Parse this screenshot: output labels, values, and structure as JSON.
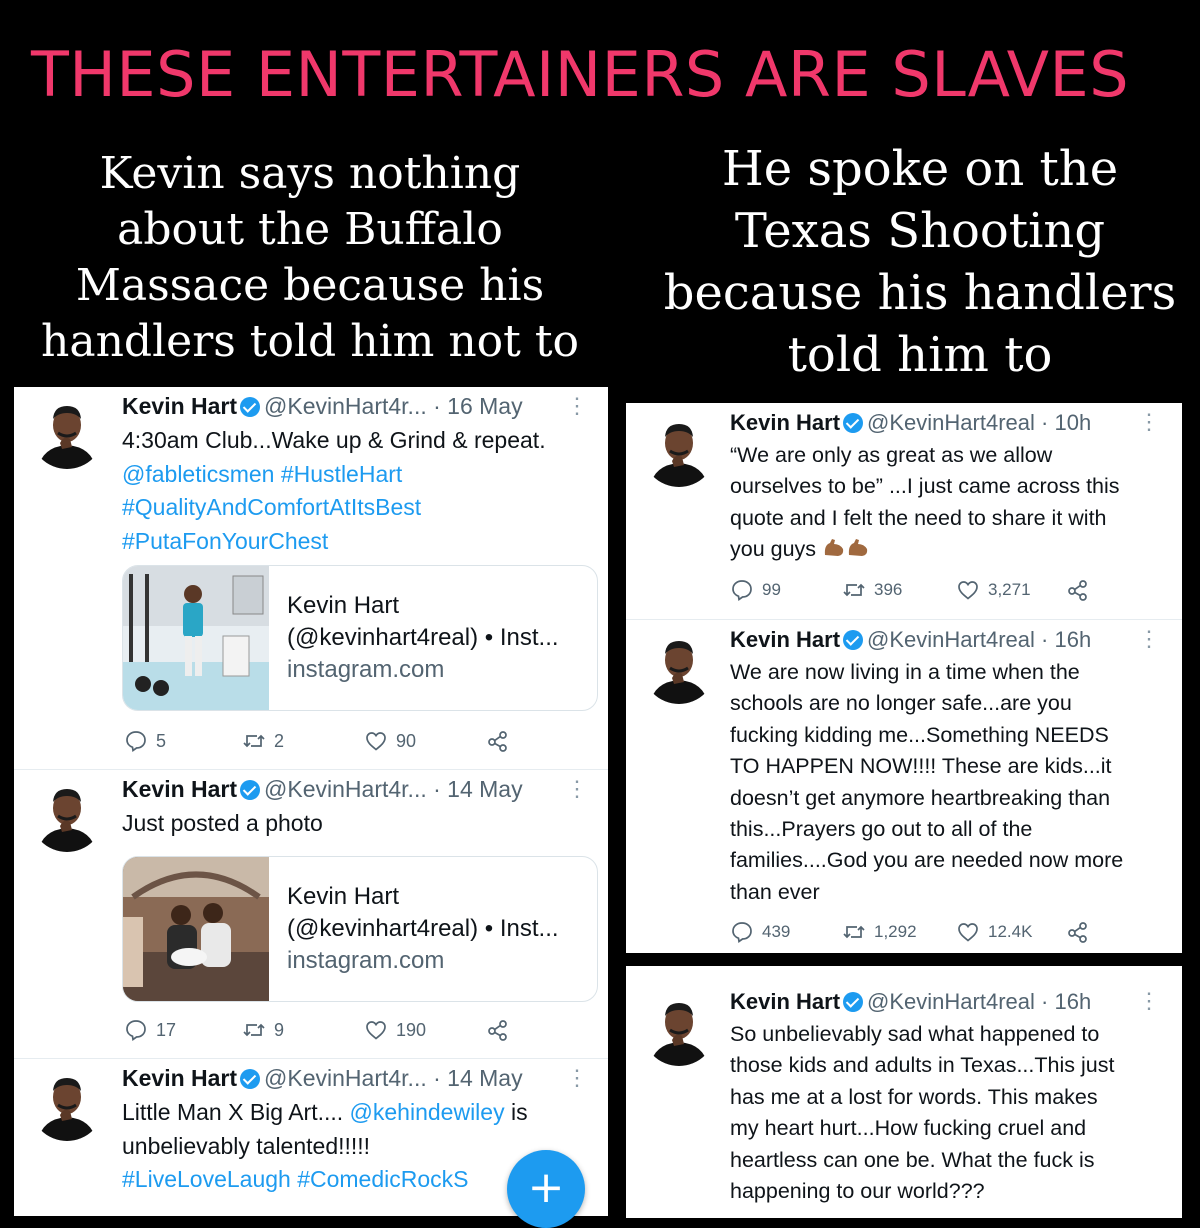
{
  "headline": "THESE ENTERTAINERS ARE SLAVES",
  "captions": {
    "left": [
      "Kevin says nothing",
      "about the Buffalo",
      "Massace because his",
      "handlers told him not to"
    ],
    "right": [
      "He spoke on the",
      "Texas Shooting",
      "because his handlers",
      "told him to"
    ]
  },
  "colors": {
    "headline": "#f0386b",
    "link": "#1d9bf0",
    "background": "#000000"
  },
  "left_tweets": [
    {
      "name": "Kevin Hart",
      "handle": "@KevinHart4r...",
      "time": "· 16 May",
      "lines": [
        "4:30am Club...Wake up & Grind & repeat."
      ],
      "link_lines": [
        "@fableticsmen #HustleHart",
        "#QualityAndComfortAtItsBest",
        "#PutaFonYourChest"
      ],
      "card": {
        "title": "Kevin Hart",
        "subtitle": "(@kevinhart4real) • Inst...",
        "domain": "instagram.com"
      },
      "replies": "5",
      "retweets": "2",
      "likes": "90"
    },
    {
      "name": "Kevin Hart",
      "handle": "@KevinHart4r...",
      "time": "· 14 May",
      "lines": [
        "Just posted a photo"
      ],
      "card": {
        "title": "Kevin Hart",
        "subtitle": "(@kevinhart4real) • Inst...",
        "domain": "instagram.com"
      },
      "replies": "17",
      "retweets": "9",
      "likes": "190"
    },
    {
      "name": "Kevin Hart",
      "handle": "@KevinHart4r...",
      "time": "· 14 May",
      "line1_a": "Little Man X Big Art.... ",
      "line1_link": "@kehindewiley",
      "line1_b": " is",
      "line2": "unbelievably talented!!!!!",
      "line3_link": "#LiveLoveLaugh #ComedicRockS"
    }
  ],
  "right_tweets": [
    {
      "name": "Kevin Hart",
      "handle": "@KevinHart4real",
      "time": "· 10h",
      "lines": [
        "“We are only as great as we allow",
        "ourselves to be” ...I just came across this",
        "quote and I felt the need to share it with",
        "you guys"
      ],
      "emoji": "flexed-biceps-icon",
      "replies": "99",
      "retweets": "396",
      "likes": "3,271"
    },
    {
      "name": "Kevin Hart",
      "handle": "@KevinHart4real",
      "time": "· 16h",
      "lines": [
        "We are now living in a time when the",
        "schools are no longer safe...are you",
        "fucking kidding me...Something NEEDS",
        "TO HAPPEN NOW!!!! These are kids...it",
        "doesn’t get anymore heartbreaking than",
        "this...Prayers go out to all of the",
        "families....God you are needed now more",
        "than ever"
      ],
      "replies": "439",
      "retweets": "1,292",
      "likes": "12.4K"
    },
    {
      "name": "Kevin Hart",
      "handle": "@KevinHart4real",
      "time": "· 16h",
      "lines": [
        "So unbelievably sad what happened to",
        "those kids and adults in Texas...This just",
        "has me at a lost for words. This makes",
        "my heart hurt...How fucking cruel and",
        "heartless can one be. What the fuck is",
        "happening to our world???"
      ]
    }
  ],
  "fab_label": "+"
}
